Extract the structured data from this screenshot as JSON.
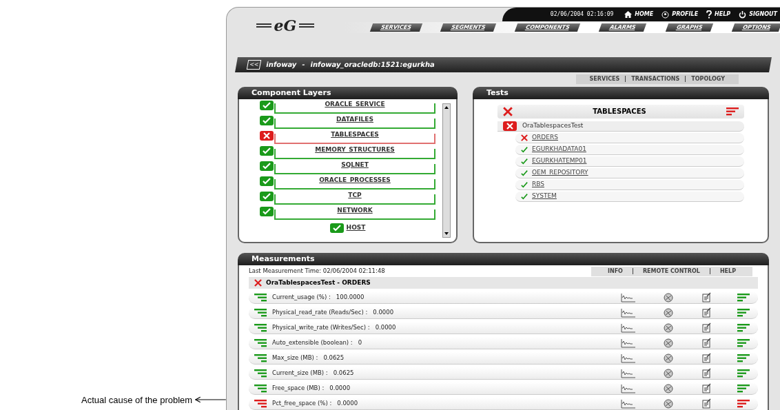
{
  "annotation": {
    "label": "Actual cause of the problem"
  },
  "header": {
    "logo": "eG",
    "datetime": "02/06/2004 02:16:09",
    "top_links": [
      {
        "label": "HOME",
        "kind": "home"
      },
      {
        "label": "PROFILE",
        "kind": "profile"
      },
      {
        "label": "HELP",
        "kind": "help"
      },
      {
        "label": "SIGNOUT",
        "kind": "signout"
      }
    ],
    "nav_tabs": [
      "SERVICES",
      "SEGMENTS",
      "COMPONENTS",
      "ALARMS",
      "GRAPHS",
      "OPTIONS"
    ]
  },
  "breadcrumb": {
    "back": "<<",
    "zone": "infoway",
    "separator": "-",
    "component": "infoway_oracledb:1521:egurkha"
  },
  "sub_links": [
    "SERVICES",
    "TRANSACTIONS",
    "TOPOLOGY"
  ],
  "layers_panel": {
    "title": "Component Layers",
    "layers": [
      {
        "label": "ORACLE_SERVICE",
        "ok": true
      },
      {
        "label": "DATAFILES",
        "ok": true
      },
      {
        "label": "TABLESPACES",
        "ok": false
      },
      {
        "label": "MEMORY_STRUCTURES",
        "ok": true
      },
      {
        "label": "SQLNET",
        "ok": true
      },
      {
        "label": "ORACLE_PROCESSES",
        "ok": true
      },
      {
        "label": "TCP",
        "ok": true
      },
      {
        "label": "NETWORK",
        "ok": true
      }
    ],
    "base": {
      "label": "HOST",
      "ok": true
    }
  },
  "tests_panel": {
    "title": "Tests",
    "layer": {
      "label": "TABLESPACES",
      "ok": false
    },
    "test": {
      "label": "OraTablespacesTest",
      "ok": false
    },
    "descriptors": [
      {
        "label": "ORDERS",
        "ok": false
      },
      {
        "label": "EGURKHADATA01",
        "ok": true
      },
      {
        "label": "EGURKHATEMP01",
        "ok": true
      },
      {
        "label": "OEM_REPOSITORY",
        "ok": true
      },
      {
        "label": "RBS",
        "ok": true
      },
      {
        "label": "SYSTEM",
        "ok": true
      }
    ]
  },
  "measurements_panel": {
    "title": "Measurements",
    "last_time": "Last Measurement Time: 02/06/2004 02:11:48",
    "links": [
      "INFO",
      "REMOTE CONTROL",
      "HELP"
    ],
    "test_title": {
      "label": "OraTablespacesTest - ORDERS",
      "ok": false
    },
    "rows": [
      {
        "label": "Current_usage (%) :",
        "value": "100.0000",
        "ok": true
      },
      {
        "label": "Physical_read_rate (Reads/Sec) :",
        "value": "0.0000",
        "ok": true
      },
      {
        "label": "Physical_write_rate (Writes/Sec) :",
        "value": "0.0000",
        "ok": true
      },
      {
        "label": "Auto_extensible (boolean) :",
        "value": "0",
        "ok": true
      },
      {
        "label": "Max_size (MB) :",
        "value": "0.0625",
        "ok": true
      },
      {
        "label": "Current_size (MB) :",
        "value": "0.0625",
        "ok": true
      },
      {
        "label": "Free_space (MB) :",
        "value": "0.0000",
        "ok": true
      },
      {
        "label": "Pct_free_space (%) :",
        "value": "0.0000",
        "ok": false
      }
    ]
  }
}
